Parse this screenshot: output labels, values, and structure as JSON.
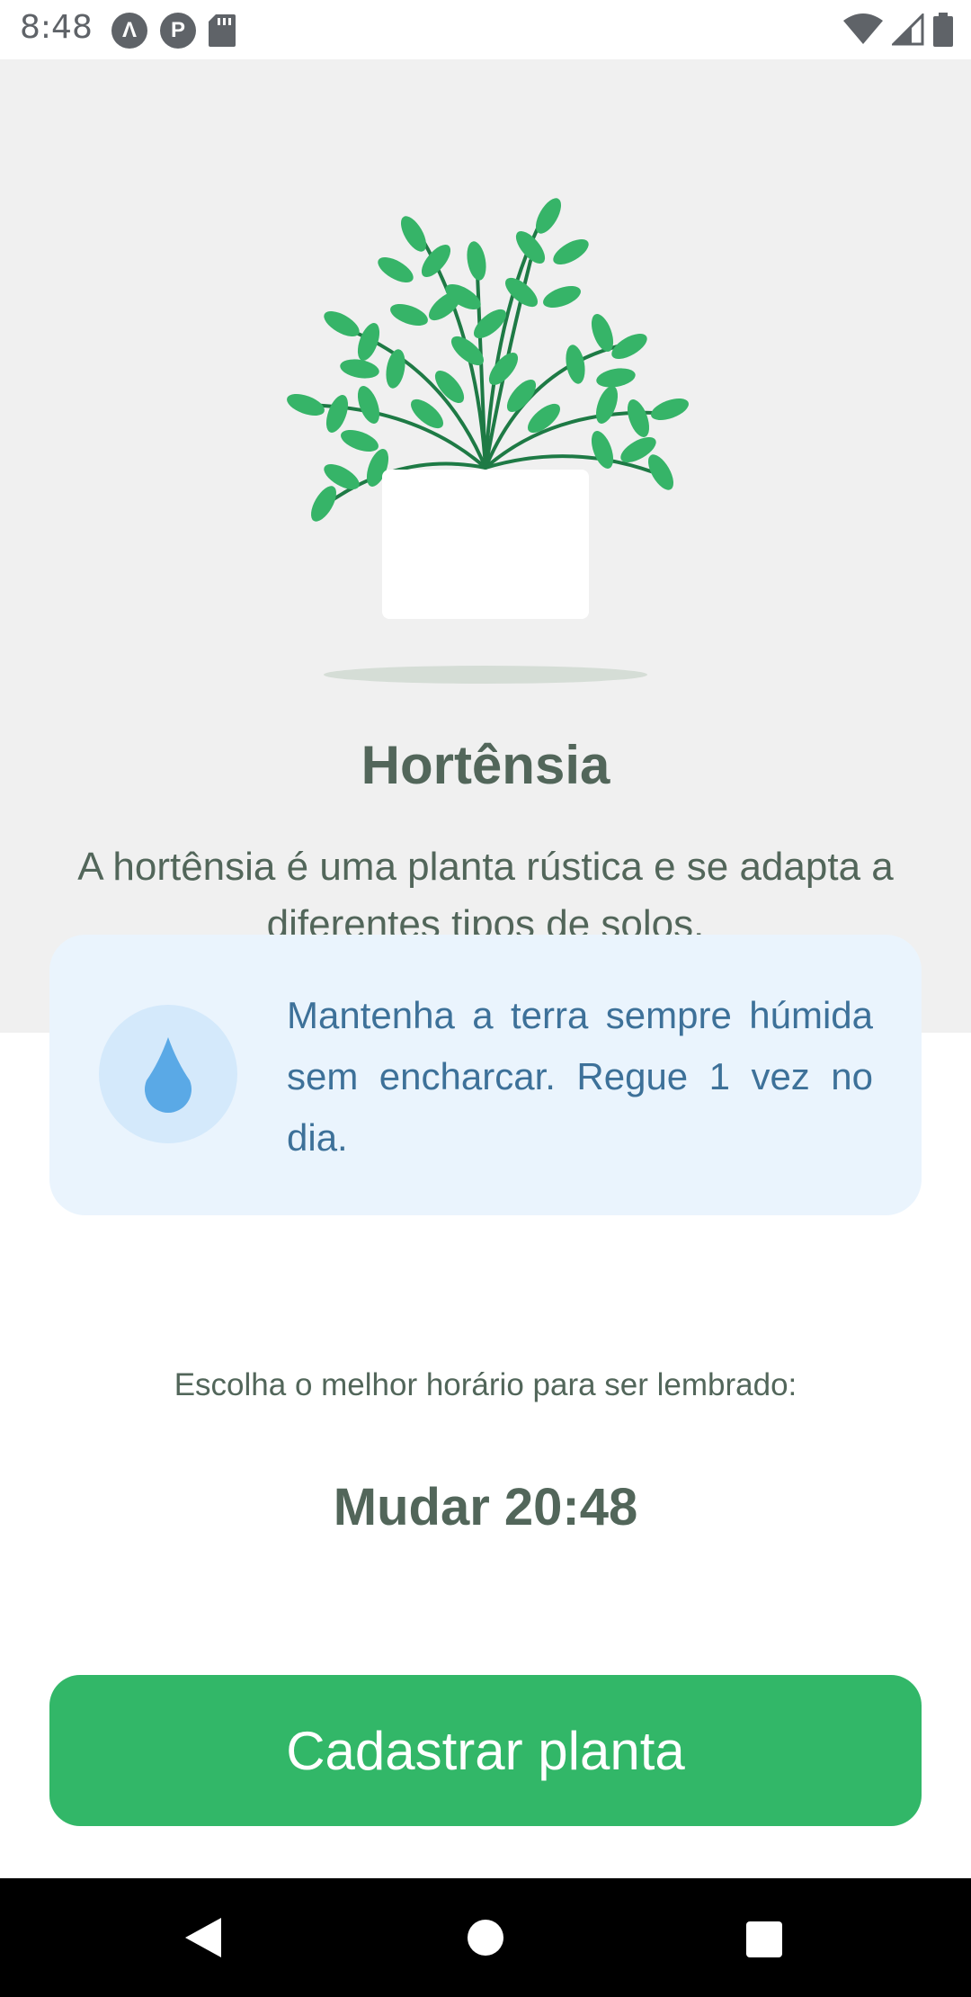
{
  "status_bar": {
    "time": "8:48",
    "left_icons": [
      "app-a-icon",
      "app-p-icon",
      "sd-card-icon"
    ],
    "right_icons": [
      "wifi-icon",
      "signal-icon",
      "battery-icon"
    ]
  },
  "plant": {
    "name": "Hortênsia",
    "about": "A hortênsia é uma planta rústica e se adapta a diferentes tipos de solos."
  },
  "water_tip": {
    "icon": "water-drop-icon",
    "text": "Mantenha a terra sempre húmida sem encharcar. Regue 1 vez no dia."
  },
  "reminder": {
    "label": "Escolha o melhor horário para ser lembrado:",
    "change_time": "Mudar 20:48"
  },
  "actions": {
    "submit_label": "Cadastrar planta"
  },
  "colors": {
    "green": "#32b768",
    "heading": "#52665a",
    "blue_text": "#3d7199",
    "card_bg": "#eaf4fd",
    "hero_bg": "#f0f0f0"
  }
}
